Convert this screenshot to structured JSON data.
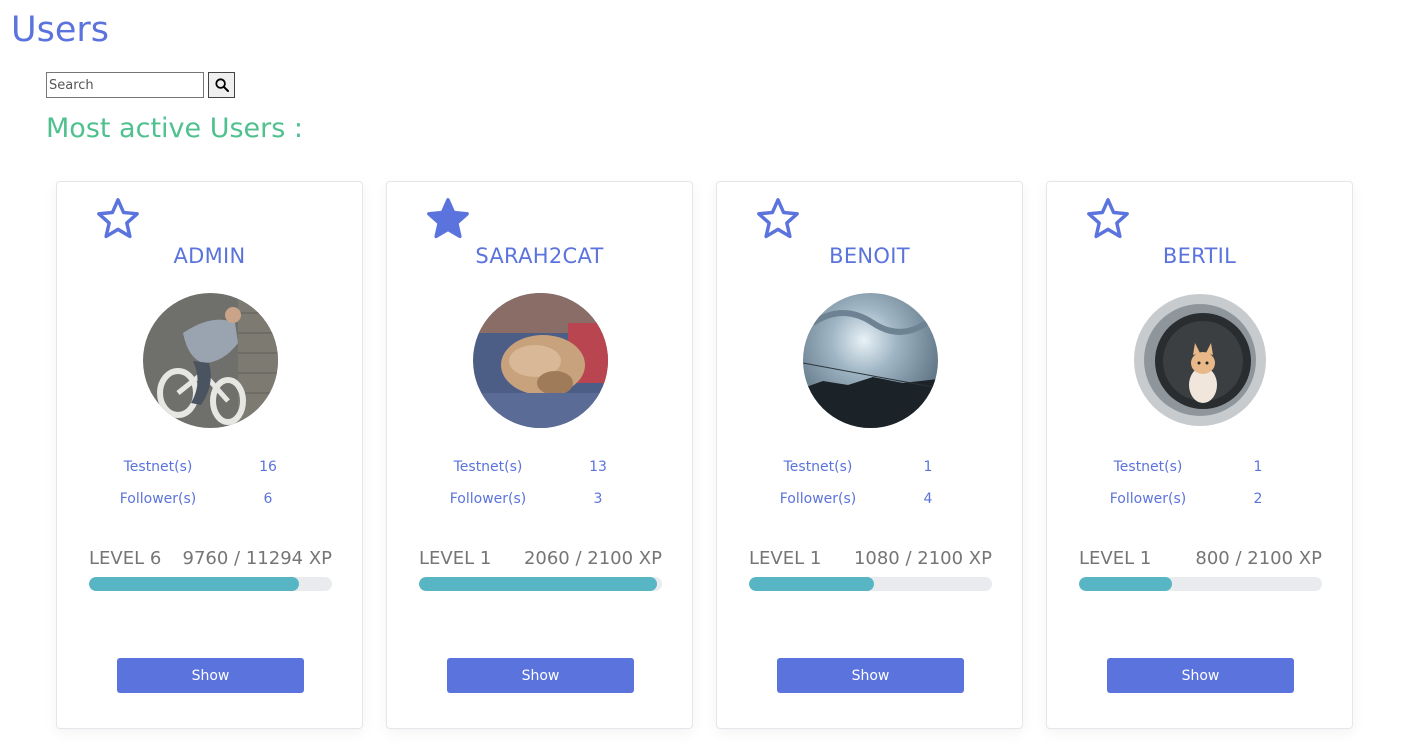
{
  "page": {
    "title": "Users",
    "section_title": "Most active Users :"
  },
  "search": {
    "placeholder": "Search",
    "value": "",
    "button_icon": "search-icon"
  },
  "colors": {
    "primary": "#5b73dc",
    "section_title": "#4fc18f",
    "progress_fill": "#58b6c4",
    "progress_track": "#e9ebef",
    "muted_text": "#757575"
  },
  "users": [
    {
      "name": "ADMIN",
      "favorite": false,
      "favorite_icon": "star-outline-icon",
      "testnets_label": "Testnet(s)",
      "testnets": "16",
      "followers_label": "Follower(s)",
      "followers": "6",
      "level": "LEVEL 6",
      "xp": "9760 / 11294 XP",
      "progress": 0.864,
      "button": "Show"
    },
    {
      "name": "SARAH2CAT",
      "favorite": true,
      "favorite_icon": "star-filled-icon",
      "testnets_label": "Testnet(s)",
      "testnets": "13",
      "followers_label": "Follower(s)",
      "followers": "3",
      "level": "LEVEL 1",
      "xp": "2060 / 2100 XP",
      "progress": 0.981,
      "button": "Show"
    },
    {
      "name": "BENOIT",
      "favorite": false,
      "favorite_icon": "star-outline-icon",
      "testnets_label": "Testnet(s)",
      "testnets": "1",
      "followers_label": "Follower(s)",
      "followers": "4",
      "level": "LEVEL 1",
      "xp": "1080 / 2100 XP",
      "progress": 0.514,
      "button": "Show"
    },
    {
      "name": "BERTIL",
      "favorite": false,
      "favorite_icon": "star-outline-icon",
      "testnets_label": "Testnet(s)",
      "testnets": "1",
      "followers_label": "Follower(s)",
      "followers": "2",
      "level": "LEVEL 1",
      "xp": "800 / 2100 XP",
      "progress": 0.381,
      "button": "Show"
    }
  ]
}
